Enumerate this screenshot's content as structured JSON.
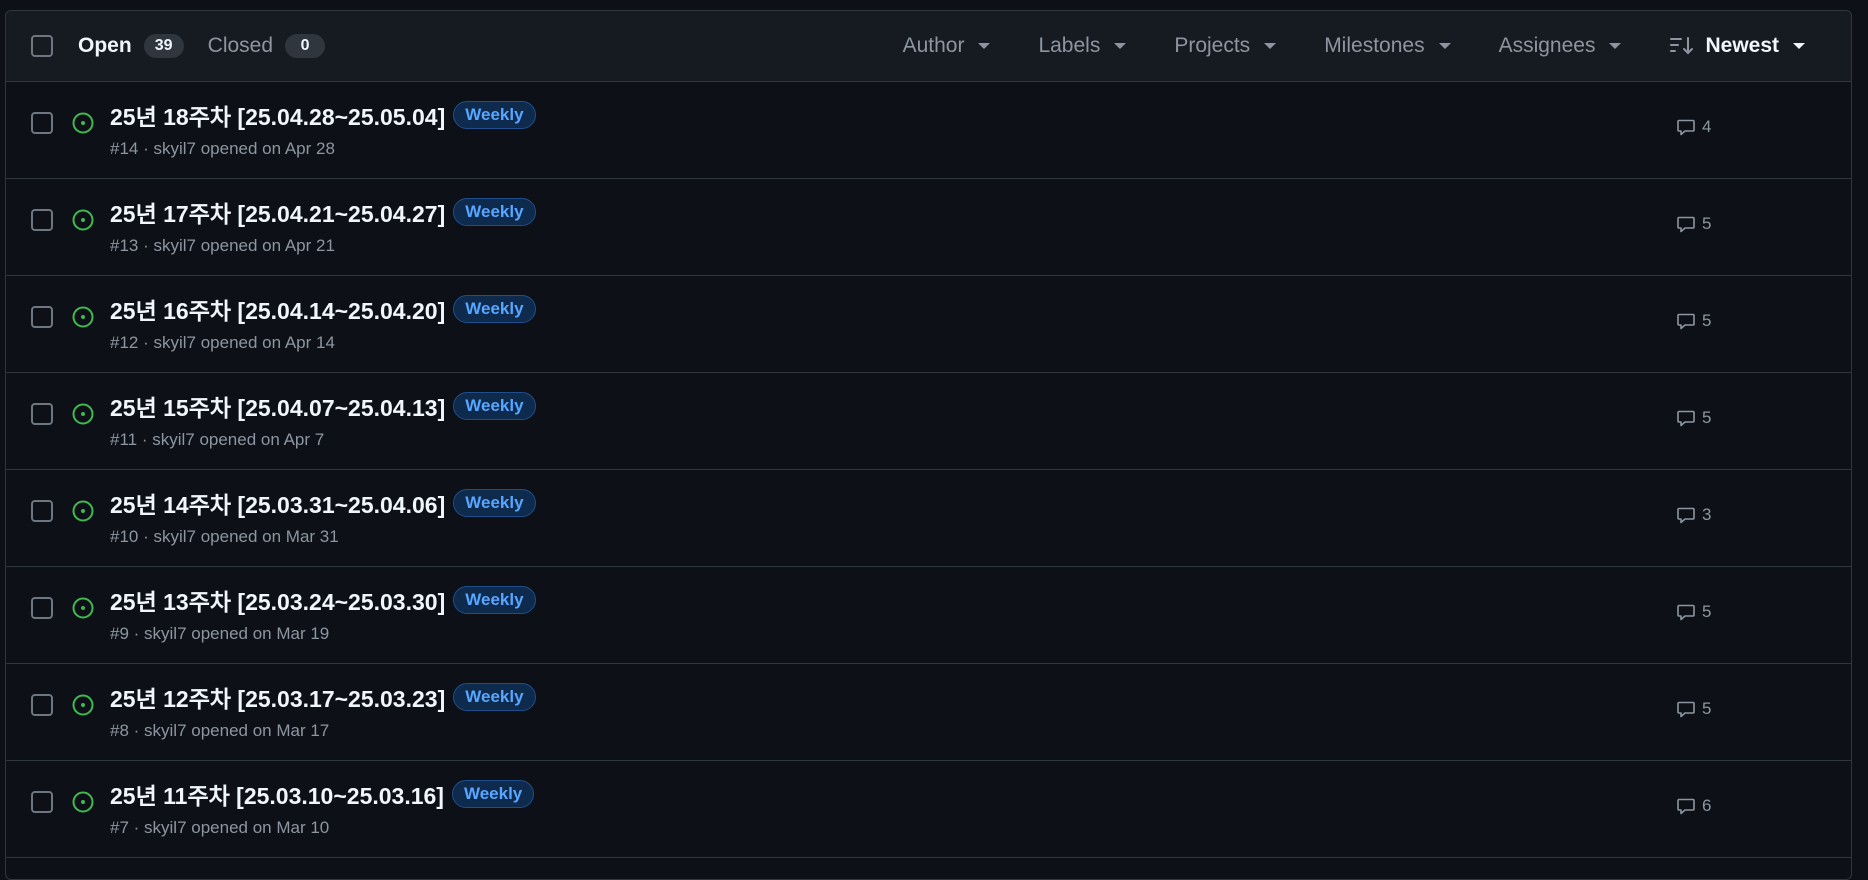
{
  "header": {
    "open_label": "Open",
    "open_count": "39",
    "closed_label": "Closed",
    "closed_count": "0",
    "filters": {
      "author": "Author",
      "labels": "Labels",
      "projects": "Projects",
      "milestones": "Milestones",
      "assignees": "Assignees"
    },
    "sort_label": "Newest"
  },
  "colors": {
    "open_icon": "#3fb950",
    "label_text": "#58a6ff",
    "background": "#0d1117"
  },
  "issues": [
    {
      "title": "25년 18주차 [25.04.28~25.05.04]",
      "label": "Weekly",
      "meta": "#14 · skyil7 opened on Apr 28",
      "comments": "4"
    },
    {
      "title": "25년 17주차 [25.04.21~25.04.27]",
      "label": "Weekly",
      "meta": "#13 · skyil7 opened on Apr 21",
      "comments": "5"
    },
    {
      "title": "25년 16주차 [25.04.14~25.04.20]",
      "label": "Weekly",
      "meta": "#12 · skyil7 opened on Apr 14",
      "comments": "5"
    },
    {
      "title": "25년 15주차 [25.04.07~25.04.13]",
      "label": "Weekly",
      "meta": "#11 · skyil7 opened on Apr 7",
      "comments": "5"
    },
    {
      "title": "25년 14주차 [25.03.31~25.04.06]",
      "label": "Weekly",
      "meta": "#10 · skyil7 opened on Mar 31",
      "comments": "3"
    },
    {
      "title": "25년 13주차 [25.03.24~25.03.30]",
      "label": "Weekly",
      "meta": "#9 · skyil7 opened on Mar 19",
      "comments": "5"
    },
    {
      "title": "25년 12주차 [25.03.17~25.03.23]",
      "label": "Weekly",
      "meta": "#8 · skyil7 opened on Mar 17",
      "comments": "5"
    },
    {
      "title": "25년 11주차 [25.03.10~25.03.16]",
      "label": "Weekly",
      "meta": "#7 · skyil7 opened on Mar 10",
      "comments": "6"
    }
  ]
}
